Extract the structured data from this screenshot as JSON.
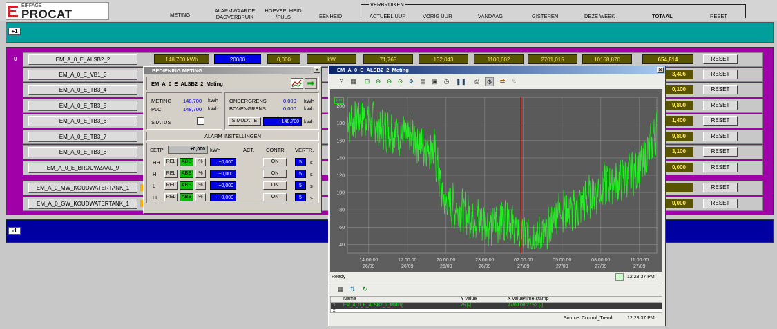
{
  "logo": {
    "sub": "EIFFAGE",
    "main": "PROCAT"
  },
  "header": {
    "col_meting": "METING",
    "col_alarm_l1": "ALARMWAARDE",
    "col_alarm_l2": "DAGVERBRUIK",
    "col_hoev_l1": "HOEVEELHEID",
    "col_hoev_l2": "/PULS",
    "col_eenheid": "EENHEID",
    "verbruiken": "VERBRUIKEN",
    "col_actueel": "ACTUEEL UUR",
    "col_vorig": "VORIG UUR",
    "col_vandaag": "VANDAAG",
    "col_gisteren": "GISTEREN",
    "col_week": "DEZE WEEK",
    "col_totaal": "TOTAAL",
    "col_reset": "RESET"
  },
  "groups": {
    "plus1": "+1",
    "zero": "0",
    "minus1": "-1"
  },
  "rows": [
    {
      "name": "EM_A_0_E_ALSB2_2",
      "meting": "148,700 kWh",
      "alarm": "20000",
      "puls": "0,000",
      "eenheid": "kW",
      "actueel": "71,765",
      "vorig": "132,043",
      "vandaag": "1100,602",
      "gisteren": "2701,015",
      "week": "10168,870",
      "totaal": "654,814",
      "reset": "RESET"
    },
    {
      "name": "EM_A_0_E_VB1_3",
      "totaal": "3,406",
      "reset": "RESET"
    },
    {
      "name": "EM_A_0_E_TB3_4",
      "totaal": "0,100",
      "reset": "RESET"
    },
    {
      "name": "EM_A_0_E_TB3_5",
      "totaal": "9,800",
      "reset": "RESET"
    },
    {
      "name": "EM_A_0_E_TB3_6",
      "totaal": "1,400",
      "reset": "RESET"
    },
    {
      "name": "EM_A_0_E_TB3_7",
      "totaal": "9,800",
      "reset": "RESET"
    },
    {
      "name": "EM_A_0_E_TB3_8",
      "totaal": "3,100",
      "reset": "RESET"
    },
    {
      "name": "EM_A_0_E_BROUWZAAL_9",
      "totaal": "0,000",
      "reset": "RESET"
    },
    {
      "name": "EM_A_0_MW_KOUDWATERTANK_1",
      "totaal": "",
      "reset": "RESET"
    },
    {
      "name": "EM_A_0_GW_KOUDWATERTANK_1",
      "totaal": "0,000",
      "reset": "RESET"
    }
  ],
  "bediening": {
    "title": "BEDIENING METING",
    "name": "EM_A_0_E_ALSB2_2_Meting",
    "meting_lbl": "METING",
    "meting_val": "148,700",
    "meting_unit": "kWh",
    "plc_lbl": "PLC",
    "plc_val": "148,700",
    "plc_unit": "kWh",
    "onder_lbl": "ONDERGRENS",
    "onder_val": "0,000",
    "onder_unit": "kWh",
    "boven_lbl": "BOVENGRENS",
    "boven_val": "0,000",
    "boven_unit": "kWh",
    "status_lbl": "STATUS",
    "simulatie_lbl": "SIMULATIE",
    "simulatie_val": "+148,700",
    "simulatie_unit": "kWh",
    "alarm_title": "ALARM INSTELLINGEN",
    "setp_lbl": "SETP",
    "setp_val": "+0,000",
    "setp_unit": "kWh",
    "act_lbl": "ACT.",
    "contr_lbl": "CONTR.",
    "vertr_lbl": "VERTR.",
    "rel": "REL",
    "abs": "ABS",
    "pct": "%",
    "levels": [
      {
        "lbl": "HH",
        "val": "+0,000",
        "on": "ON",
        "delay": "5",
        "unit": "s"
      },
      {
        "lbl": "H",
        "val": "+0,000",
        "on": "ON",
        "delay": "5",
        "unit": "s"
      },
      {
        "lbl": "L",
        "val": "+0,000",
        "on": "ON",
        "delay": "5",
        "unit": "s"
      },
      {
        "lbl": "LL",
        "val": "+0,000",
        "on": "ON",
        "delay": "5",
        "unit": "s"
      }
    ]
  },
  "trend": {
    "title": "EM_A_0_E_ALSB2_2_Meting",
    "act": "Act",
    "yticks": [
      "200",
      "180",
      "160",
      "140",
      "120",
      "100",
      "80",
      "60",
      "40"
    ],
    "xticks": [
      {
        "t": "14:00:00",
        "d": "26/09"
      },
      {
        "t": "17:00:00",
        "d": "26/09"
      },
      {
        "t": "20:00:00",
        "d": "26/09"
      },
      {
        "t": "23:00:00",
        "d": "26/09"
      },
      {
        "t": "02:00:00",
        "d": "27/09"
      },
      {
        "t": "05:00:00",
        "d": "27/09"
      },
      {
        "t": "08:00:00",
        "d": "27/09"
      },
      {
        "t": "11:00:00",
        "d": "27/09"
      }
    ],
    "status_ready": "Ready",
    "time": "12:28:37 PM",
    "col_name": "Name",
    "col_y": "Y value",
    "col_x": "X value/time stamp",
    "row1_idx": "1",
    "row1_name": "EM_A_0_E_ALSB2_2_Meting",
    "row1_y": "75 [-]",
    "row1_x": "27/09 00:27:53 [-]",
    "row2_idx": "2",
    "source": "Source: Control_Trend",
    "line_color": "#22ee22",
    "cursor_color": "#e00000"
  }
}
